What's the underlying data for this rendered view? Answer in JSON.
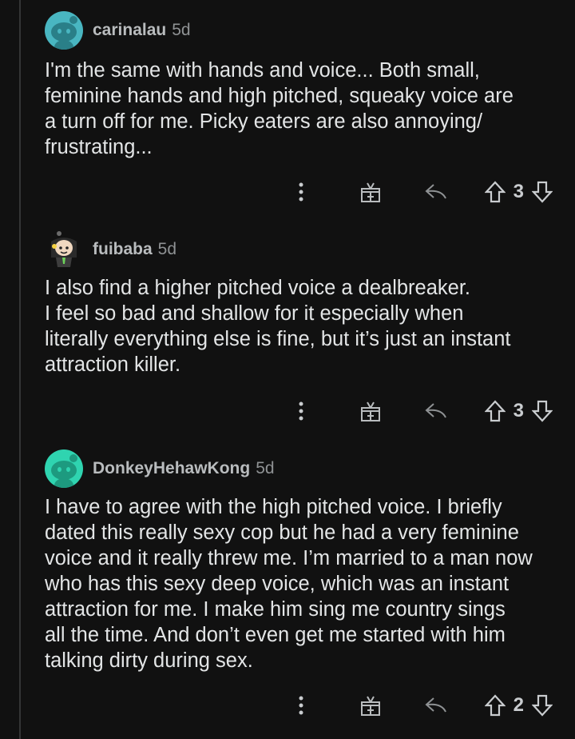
{
  "comments": [
    {
      "username": "carinalau",
      "age": "5d",
      "avatar": "snoo-avatar-icon",
      "body": "I'm the same with hands and voice... Both small,\nfeminine hands and high pitched, squeaky voice are\na turn off for me. Picky eaters are also annoying/\nfrustrating...",
      "votes": "3"
    },
    {
      "username": "fuibaba",
      "age": "5d",
      "avatar": "custom-avatar-icon",
      "body": "I also find a higher pitched voice a dealbreaker.\nI feel so bad and shallow for it especially when\nliterally everything else is fine, but it’s just an instant\nattraction killer.",
      "votes": "3"
    },
    {
      "username": "DonkeyHehawKong",
      "age": "5d",
      "avatar": "snoo-avatar-icon",
      "body": "I have to agree with the high pitched voice. I briefly\ndated this really sexy cop but he had a very feminine\nvoice and it really threw me. I’m married to a man now\nwho has this sexy deep voice, which was an instant\nattraction for me. I make him sing me country sings\nall the time. And don’t even get me started with him\ntalking dirty during sex.",
      "votes": "2"
    }
  ],
  "colors": {
    "background": "#111111",
    "text": "#e3e5e6",
    "meta": "#8f9294",
    "snoo_blue": "#49b6c1",
    "snoo_green": "#2fd4b0"
  },
  "icons": {
    "more": "more-options-icon",
    "award": "award-gift-icon",
    "reply": "reply-arrow-icon",
    "upvote": "upvote-arrow-icon",
    "downvote": "downvote-arrow-icon"
  }
}
